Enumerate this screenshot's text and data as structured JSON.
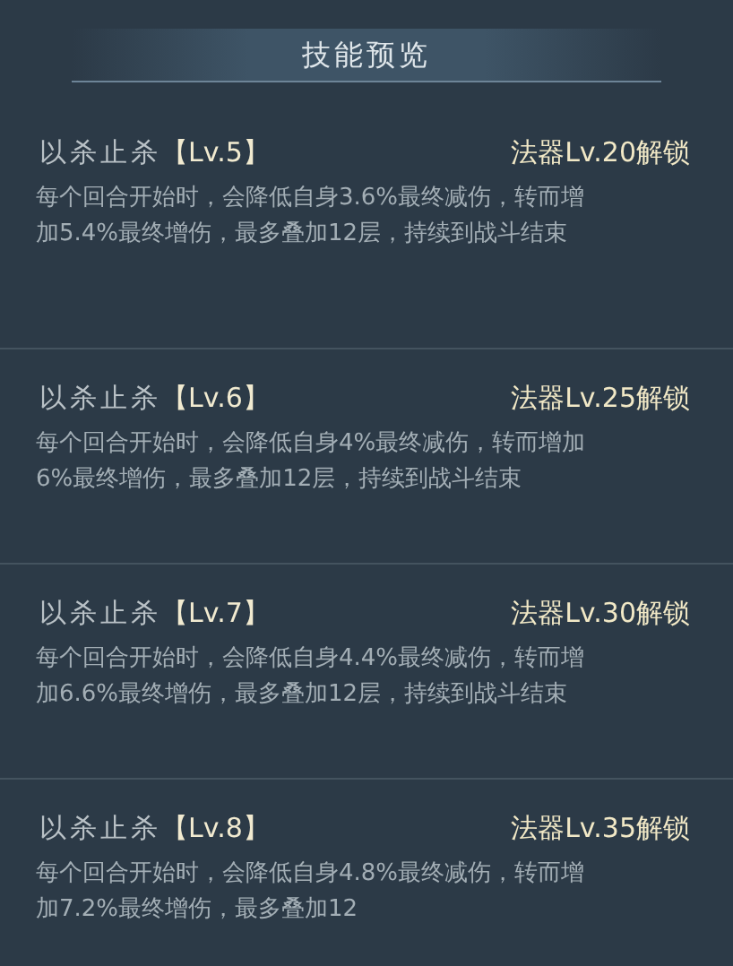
{
  "title": "技能预览",
  "skills": [
    {
      "name": "以杀止杀",
      "level": "【Lv.5】",
      "unlock": "法器Lv.20解锁",
      "lines": [
        "每个回合开始时，会降低自身3.6%最终减伤，转而增",
        "加5.4%最终增伤，最多叠加12层，持续到战斗结束"
      ]
    },
    {
      "name": "以杀止杀",
      "level": "【Lv.6】",
      "unlock": "法器Lv.25解锁",
      "lines": [
        "每个回合开始时，会降低自身4%最终减伤，转而增加",
        "6%最终增伤，最多叠加12层，持续到战斗结束"
      ]
    },
    {
      "name": "以杀止杀",
      "level": "【Lv.7】",
      "unlock": "法器Lv.30解锁",
      "lines": [
        "每个回合开始时，会降低自身4.4%最终减伤，转而增",
        "加6.6%最终增伤，最多叠加12层，持续到战斗结束"
      ]
    },
    {
      "name": "以杀止杀",
      "level": "【Lv.8】",
      "unlock": "法器Lv.35解锁",
      "lines": [
        "每个回合开始时，会降低自身4.8%最终减伤，转而增",
        "加7.2%最终增伤，最多叠加12"
      ]
    }
  ]
}
